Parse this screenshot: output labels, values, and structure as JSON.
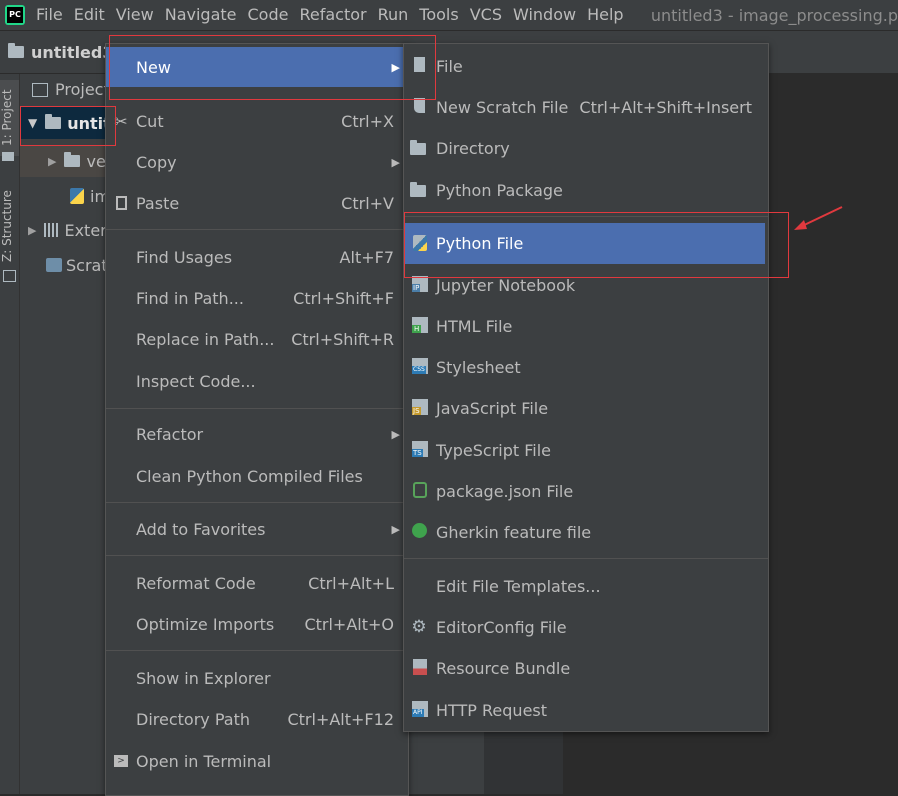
{
  "menubar": {
    "items": [
      "File",
      "Edit",
      "View",
      "Navigate",
      "Code",
      "Refactor",
      "Run",
      "Tools",
      "VCS",
      "Window",
      "Help"
    ],
    "window_title": "untitled3 - image_processing.p"
  },
  "navbar": {
    "project": "untitled3"
  },
  "side_tabs": {
    "project": "1: Project",
    "structure": "Z: Structure"
  },
  "project_panel": {
    "header": "Project",
    "tree": [
      {
        "label": "untit",
        "state": "selected"
      },
      {
        "label": "ve",
        "state": "highlight"
      },
      {
        "label": "im",
        "state": "normal"
      },
      {
        "label": "Exter",
        "state": "normal"
      },
      {
        "label": "Scrat",
        "state": "normal"
      }
    ]
  },
  "context_menu": {
    "items": [
      {
        "label": "New",
        "shortcut": "",
        "submenu": true,
        "icon": "",
        "active": true
      },
      {
        "label": "Cut",
        "shortcut": "Ctrl+X",
        "submenu": false,
        "icon": "scissors-icon"
      },
      {
        "label": "Copy",
        "shortcut": "",
        "submenu": true,
        "icon": ""
      },
      {
        "label": "Paste",
        "shortcut": "Ctrl+V",
        "submenu": false,
        "icon": "clipboard-icon"
      },
      {
        "label": "Find Usages",
        "shortcut": "Alt+F7",
        "submenu": false,
        "icon": ""
      },
      {
        "label": "Find in Path...",
        "shortcut": "Ctrl+Shift+F",
        "submenu": false,
        "icon": ""
      },
      {
        "label": "Replace in Path...",
        "shortcut": "Ctrl+Shift+R",
        "submenu": false,
        "icon": ""
      },
      {
        "label": "Inspect Code...",
        "shortcut": "",
        "submenu": false,
        "icon": ""
      },
      {
        "label": "Refactor",
        "shortcut": "",
        "submenu": true,
        "icon": ""
      },
      {
        "label": "Clean Python Compiled Files",
        "shortcut": "",
        "submenu": false,
        "icon": ""
      },
      {
        "label": "Add to Favorites",
        "shortcut": "",
        "submenu": true,
        "icon": ""
      },
      {
        "label": "Reformat Code",
        "shortcut": "Ctrl+Alt+L",
        "submenu": false,
        "icon": ""
      },
      {
        "label": "Optimize Imports",
        "shortcut": "Ctrl+Alt+O",
        "submenu": false,
        "icon": ""
      },
      {
        "label": "Show in Explorer",
        "shortcut": "",
        "submenu": false,
        "icon": ""
      },
      {
        "label": "Directory Path",
        "shortcut": "Ctrl+Alt+F12",
        "submenu": false,
        "icon": ""
      },
      {
        "label": "Open in Terminal",
        "shortcut": "",
        "submenu": false,
        "icon": "terminal-icon"
      }
    ]
  },
  "new_submenu": {
    "items": [
      {
        "label": "File",
        "shortcut": "",
        "icon": "file-icon"
      },
      {
        "label": "New Scratch File",
        "shortcut": "Ctrl+Alt+Shift+Insert",
        "icon": "scratch-file-icon"
      },
      {
        "label": "Directory",
        "shortcut": "",
        "icon": "folder-icon"
      },
      {
        "label": "Python Package",
        "shortcut": "",
        "icon": "package-icon"
      },
      {
        "label": "Python File",
        "shortcut": "",
        "icon": "python-file-icon",
        "active": true
      },
      {
        "label": "Jupyter Notebook",
        "shortcut": "",
        "icon": "jupyter-icon"
      },
      {
        "label": "HTML File",
        "shortcut": "",
        "icon": "html-file-icon"
      },
      {
        "label": "Stylesheet",
        "shortcut": "",
        "icon": "css-file-icon"
      },
      {
        "label": "JavaScript File",
        "shortcut": "",
        "icon": "js-file-icon"
      },
      {
        "label": "TypeScript File",
        "shortcut": "",
        "icon": "ts-file-icon"
      },
      {
        "label": "package.json File",
        "shortcut": "",
        "icon": "nodejs-icon"
      },
      {
        "label": "Gherkin feature file",
        "shortcut": "",
        "icon": "gherkin-icon"
      },
      {
        "label": "Edit File Templates...",
        "shortcut": "",
        "icon": ""
      },
      {
        "label": "EditorConfig File",
        "shortcut": "",
        "icon": "gear-icon"
      },
      {
        "label": "Resource Bundle",
        "shortcut": "",
        "icon": "resource-bundle-icon"
      },
      {
        "label": "HTTP Request",
        "shortcut": "",
        "icon": "api-icon"
      }
    ],
    "icon_tags": {
      "jupyter": "IP",
      "html": "H",
      "css": "CSS",
      "js": "JS",
      "ts": "TS",
      "api": "API"
    }
  },
  "colors": {
    "accent": "#4b6eaf",
    "annotation": "#e0393e",
    "gherkin": "#3fa34d",
    "js": "#c49a2e",
    "ts": "#2d7bb5",
    "node": "#58a35a"
  }
}
